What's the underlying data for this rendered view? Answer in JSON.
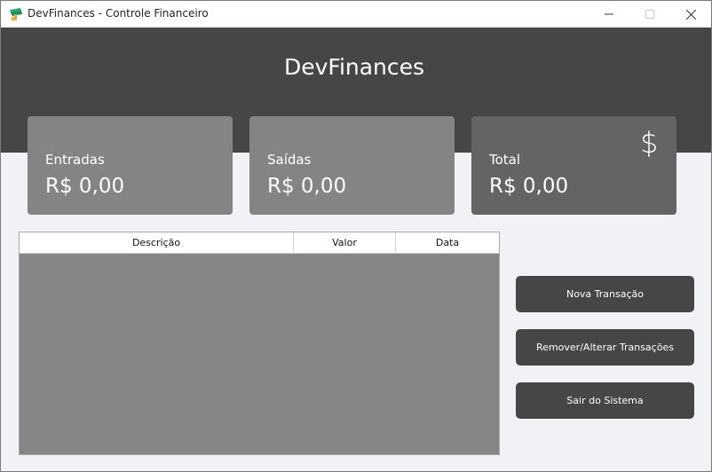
{
  "window": {
    "title": "DevFinances - Controle Financeiro",
    "icon": "money-stack-icon",
    "controls": [
      "minimize-icon",
      "maximize-icon",
      "close-icon"
    ]
  },
  "header": {
    "title": "DevFinances"
  },
  "cards": {
    "entradas": {
      "label": "Entradas",
      "value": "R$ 0,00"
    },
    "saidas": {
      "label": "Saídas",
      "value": "R$ 0,00"
    },
    "total": {
      "label": "Total",
      "value": "R$ 0,00",
      "icon": "dollar-icon",
      "icon_glyph": "$"
    }
  },
  "table": {
    "columns": [
      "Descrição",
      "Valor",
      "Data"
    ],
    "rows": []
  },
  "actions": {
    "nova": "Nova Transação",
    "remover": "Remover/Alterar Transações",
    "sair": "Sair do Sistema"
  },
  "colors": {
    "header_bg": "#464646",
    "card_bg": "#848484",
    "total_card_bg": "#646464",
    "button_bg": "#464646",
    "table_body_bg": "#868686",
    "page_bg": "#f0f2f5",
    "icon_green": "#2ea87a"
  }
}
